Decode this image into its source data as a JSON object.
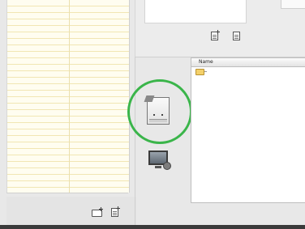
{
  "file_browser": {
    "column_header": "Name",
    "rows": [
      {
        "icon": "folder-icon",
        "label": ""
      }
    ]
  },
  "top_toolbar": {
    "icons": [
      "new-document-icon",
      "document-list-icon"
    ]
  },
  "left_footer": {
    "icons": [
      "new-folder-icon",
      "new-document-icon"
    ]
  },
  "middle_icons": {
    "highlighted": "drive-icon",
    "other": "monitor-icon"
  },
  "colors": {
    "highlight_ring": "#3ab54a",
    "list_background": "#fffdf0",
    "folder": "#f3d06a"
  }
}
